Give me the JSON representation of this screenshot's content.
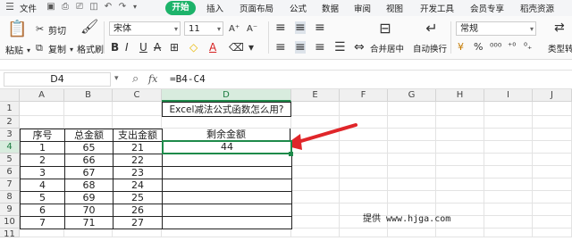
{
  "menu": {
    "file": "文件",
    "tabs": [
      "开始",
      "插入",
      "页面布局",
      "公式",
      "数据",
      "审阅",
      "视图",
      "开发工具",
      "会员专享",
      "稻壳资源"
    ]
  },
  "ribbon": {
    "paste": "粘贴",
    "cut": "剪切",
    "copy": "复制",
    "format_painter": "格式刷",
    "font_name": "宋体",
    "font_size": "11",
    "merge_center": "合并居中",
    "wrap_text": "自动换行",
    "number_format": "常规",
    "type_convert": "类型转"
  },
  "formula_bar": {
    "name_box": "D4",
    "fx": "fx",
    "formula": "=B4-C4"
  },
  "columns": [
    "A",
    "B",
    "C",
    "D",
    "E",
    "F",
    "G",
    "H",
    "I",
    "J"
  ],
  "rows": [
    "1",
    "2",
    "3",
    "4",
    "5",
    "6",
    "7",
    "8",
    "9",
    "10",
    "11"
  ],
  "sheet": {
    "title": "Excel减法公式函数怎么用?",
    "headers": [
      "序号",
      "总金额",
      "支出金额",
      "剩余金额"
    ],
    "data": [
      [
        "1",
        "65",
        "21"
      ],
      [
        "2",
        "66",
        "22"
      ],
      [
        "3",
        "67",
        "23"
      ],
      [
        "4",
        "68",
        "24"
      ],
      [
        "5",
        "69",
        "25"
      ],
      [
        "6",
        "70",
        "26"
      ],
      [
        "7",
        "71",
        "27"
      ]
    ],
    "result": "44",
    "watermark": "提供 www.hjga.com"
  },
  "colors": {
    "accent": "#1db36a",
    "arrow": "#e0262a",
    "select": "#1e8a4a"
  }
}
